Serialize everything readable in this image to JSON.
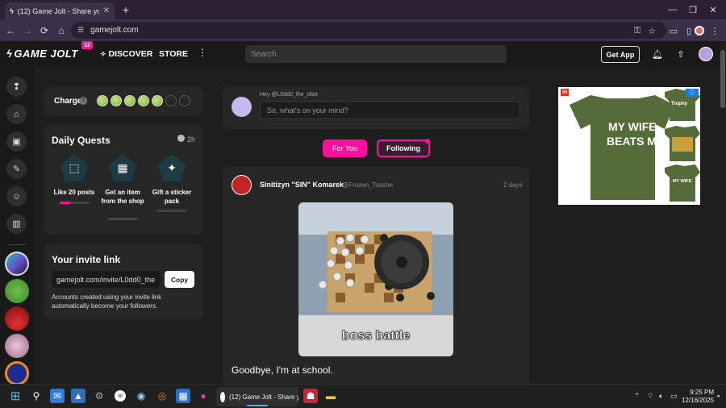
{
  "browser": {
    "tab_title": "(12) Game Jolt - Share your cre",
    "tab_close": "✕",
    "new_tab": "+",
    "window_controls": [
      "—",
      "❐",
      "✕"
    ],
    "nav": {
      "back": "←",
      "forward": "→",
      "reload": "⟳",
      "home": "⌂"
    },
    "url": "gamejolt.com"
  },
  "header": {
    "logo": "GAME JOLT",
    "notification_count": "12",
    "nav_discover": "DISCOVER",
    "nav_store": "STORE",
    "more": "⋮",
    "search_placeholder": "Search",
    "get_app": "Get App"
  },
  "charge": {
    "label": "Charge",
    "filled": 5,
    "total": 7
  },
  "daily_quests": {
    "title": "Daily Quests",
    "time_left": "2h",
    "quests": [
      {
        "label": "Like 20 posts",
        "progress": 0.35
      },
      {
        "label": "Get an item from the shop",
        "progress": 0
      },
      {
        "label": "Gift a sticker pack",
        "progress": 0
      }
    ]
  },
  "invite": {
    "title": "Your invite link",
    "link": "gamejolt.com/invite/L0dd0_the",
    "copy": "Copy",
    "description": "Accounts created using your invite link automatically become your followers."
  },
  "composer": {
    "greeting": "Hey @L0dd0_the_Idiot",
    "placeholder": "So, what's on your mind?"
  },
  "feed_tabs": {
    "for_you": "For You",
    "following": "Following"
  },
  "post": {
    "author": "Sinitizyn \"SIN\" Komarek",
    "handle": "@Frozen_Toaster",
    "time": "2 days",
    "image_caption": "boss battle",
    "text": "Goodbye, I'm at school."
  },
  "ad": {
    "badge": "in",
    "headline": "MY WIFE BEATS ME",
    "small_shirt_1": "Trophy HUSBAND",
    "small_shirt_3": "MY WIFE BEATS ME"
  },
  "taskbar": {
    "chrome_item": "(12) Game Jolt - Share y",
    "time": "9:25 PM",
    "date": "12/16/2025"
  },
  "colors": {
    "accent": "#ff0f9c",
    "panel": "#262626",
    "background": "#1e1e1e",
    "quest_icon": "#1d3a45"
  }
}
